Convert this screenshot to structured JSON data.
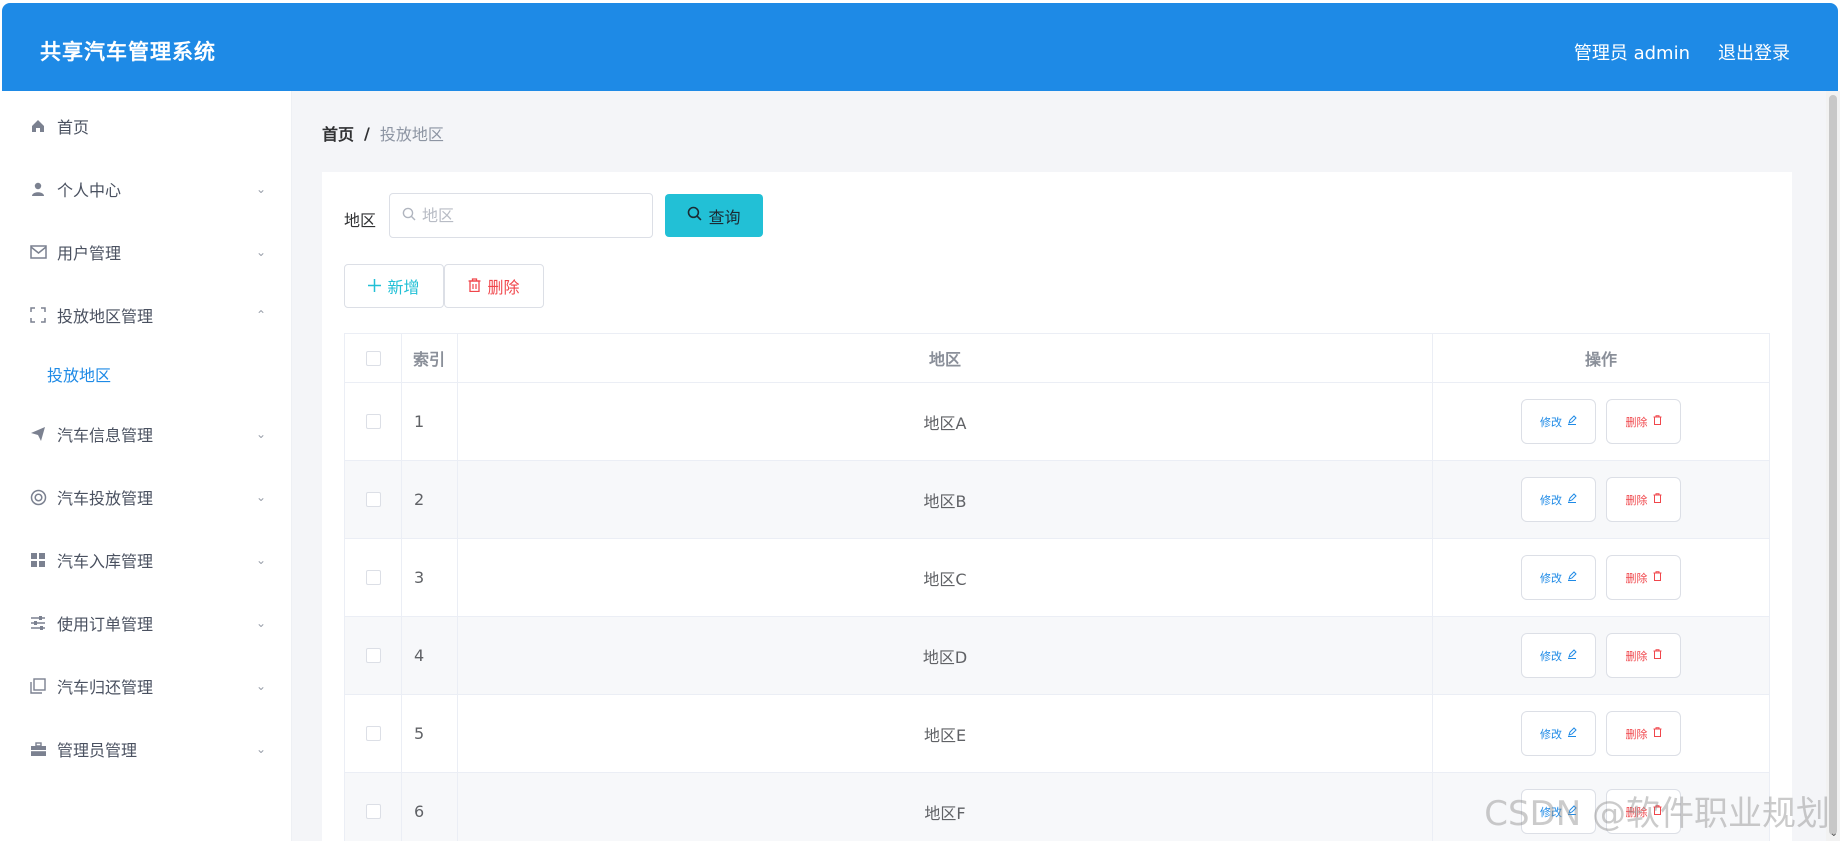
{
  "header": {
    "title": "共享汽车管理系统",
    "user_label": "管理员 admin",
    "logout_label": "退出登录"
  },
  "sidebar": {
    "items": [
      {
        "label": "首页",
        "icon": "home-icon",
        "expandable": false
      },
      {
        "label": "个人中心",
        "icon": "user-icon",
        "expandable": true
      },
      {
        "label": "用户管理",
        "icon": "mail-icon",
        "expandable": true
      },
      {
        "label": "投放地区管理",
        "icon": "fullscreen-icon",
        "expandable": true,
        "expanded": true,
        "children": [
          "投放地区"
        ]
      },
      {
        "label": "汽车信息管理",
        "icon": "send-icon",
        "expandable": true
      },
      {
        "label": "汽车投放管理",
        "icon": "lifebuoy-icon",
        "expandable": true
      },
      {
        "label": "汽车入库管理",
        "icon": "grid-icon",
        "expandable": true
      },
      {
        "label": "使用订单管理",
        "icon": "sliders-icon",
        "expandable": true
      },
      {
        "label": "汽车归还管理",
        "icon": "copy-icon",
        "expandable": true
      },
      {
        "label": "管理员管理",
        "icon": "briefcase-icon",
        "expandable": true
      }
    ],
    "active_sub": "投放地区"
  },
  "breadcrumb": {
    "home": "首页",
    "separator": "/",
    "current": "投放地区"
  },
  "filter": {
    "label": "地区",
    "placeholder": "地区",
    "value": "",
    "query_label": "查询"
  },
  "actions": {
    "add_label": "新增",
    "delete_label": "删除"
  },
  "table": {
    "columns": [
      "索引",
      "地区",
      "操作"
    ],
    "rows": [
      {
        "index": "1",
        "area": "地区A"
      },
      {
        "index": "2",
        "area": "地区B"
      },
      {
        "index": "3",
        "area": "地区C"
      },
      {
        "index": "4",
        "area": "地区D"
      },
      {
        "index": "5",
        "area": "地区E"
      },
      {
        "index": "6",
        "area": "地区F"
      }
    ],
    "row_edit_label": "修改",
    "row_delete_label": "删除"
  },
  "watermark": "CSDN @软件职业规划",
  "colors": {
    "primary": "#1e8ae6",
    "accent": "#22c0d6",
    "danger": "#f0464b"
  }
}
